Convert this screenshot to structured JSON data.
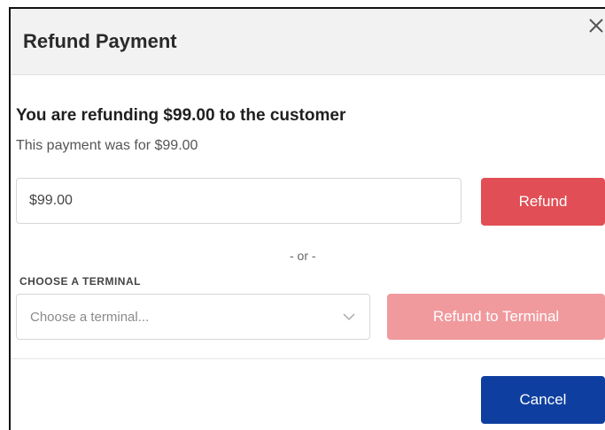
{
  "dialog": {
    "title": "Refund Payment",
    "close_icon": "close-icon"
  },
  "summary": {
    "heading": "You are refunding $99.00 to the customer",
    "subtext": "This payment was for $99.00"
  },
  "amount": {
    "value": "$99.00",
    "refund_label": "Refund"
  },
  "separator": "- or -",
  "terminal": {
    "label": "CHOOSE A TERMINAL",
    "placeholder": "Choose a terminal...",
    "chevron_icon": "chevron-down-icon",
    "refund_label": "Refund to Terminal"
  },
  "footer": {
    "cancel_label": "Cancel"
  },
  "colors": {
    "refund": "#e14e55",
    "refund_disabled": "#f09a9e",
    "cancel": "#0e3fa0",
    "header_bg": "#f2f2f2"
  }
}
